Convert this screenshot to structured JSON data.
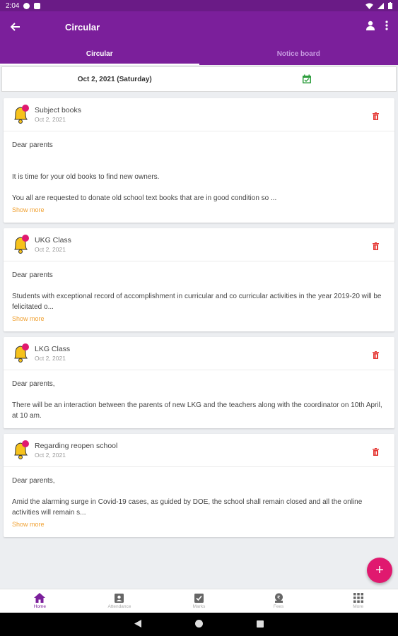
{
  "status_bar": {
    "time": "2:04"
  },
  "app_bar": {
    "title": "Circular"
  },
  "tabs": [
    {
      "label": "Circular",
      "active": true
    },
    {
      "label": "Notice board",
      "active": false
    }
  ],
  "date_filter": {
    "date": "Oct 2, 2021 (Saturday)"
  },
  "circulars": [
    {
      "title": "Subject books",
      "date": "Oct 2, 2021",
      "paragraphs": [
        "Dear parents",
        "It is time for your old books to find new owners.",
        "You all are requested to donate old school text books that are in good condition so ..."
      ],
      "show_more": "Show more"
    },
    {
      "title": "UKG Class",
      "date": "Oct 2, 2021",
      "paragraphs": [
        "Dear parents",
        "Students with exceptional record of accomplishment in curricular and co curricular activities in the year 2019-20  will be felicitated o..."
      ],
      "show_more": "Show more"
    },
    {
      "title": "LKG Class",
      "date": "Oct 2, 2021",
      "paragraphs": [
        "Dear parents,",
        "There will be an interaction between the parents of new LKG and the teachers along with the coordinator on 10th April, at 10 am."
      ],
      "show_more": ""
    },
    {
      "title": "Regarding reopen school",
      "date": "Oct 2, 2021",
      "paragraphs": [
        "Dear parents,",
        "Amid the alarming surge in Covid-19 cases, as guided by DOE, the school shall remain closed and all the online activities will remain s..."
      ],
      "show_more": "Show more"
    }
  ],
  "fab": {
    "icon": "+"
  },
  "bottom_nav": [
    {
      "label": "Home",
      "icon": "home-icon",
      "active": true
    },
    {
      "label": "Attendance",
      "icon": "attendance-icon",
      "active": false
    },
    {
      "label": "Marks",
      "icon": "marks-icon",
      "active": false
    },
    {
      "label": "Fees",
      "icon": "fees-icon",
      "active": false
    },
    {
      "label": "More",
      "icon": "grid-icon",
      "active": false
    }
  ],
  "colors": {
    "primary": "#7b1f9b",
    "accent": "#e0196f",
    "show_more": "#f0a030",
    "delete": "#e53935",
    "calendar": "#2e9e3e"
  }
}
